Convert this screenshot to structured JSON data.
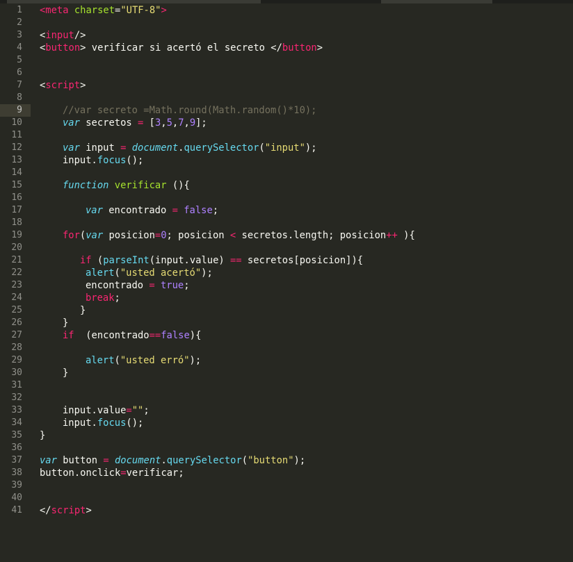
{
  "editor": {
    "lines": [
      {
        "n": "1",
        "indent": 0,
        "tokens": [
          [
            "tag",
            "<meta"
          ],
          [
            "plain",
            " "
          ],
          [
            "attr",
            "charset"
          ],
          [
            "plain",
            "="
          ],
          [
            "str",
            "\"UTF-8\""
          ],
          [
            "tag",
            ">"
          ]
        ]
      },
      {
        "n": "2",
        "indent": 0,
        "tokens": []
      },
      {
        "n": "3",
        "indent": 0,
        "tokens": [
          [
            "plain",
            "<"
          ],
          [
            "tag",
            "input"
          ],
          [
            "plain",
            "/>"
          ]
        ]
      },
      {
        "n": "4",
        "indent": 0,
        "tokens": [
          [
            "plain",
            "<"
          ],
          [
            "tag",
            "button"
          ],
          [
            "plain",
            "> verificar si acertó el secreto </"
          ],
          [
            "tag",
            "button"
          ],
          [
            "plain",
            ">"
          ]
        ]
      },
      {
        "n": "5",
        "indent": 0,
        "tokens": []
      },
      {
        "n": "6",
        "indent": 0,
        "tokens": []
      },
      {
        "n": "7",
        "indent": 0,
        "tokens": [
          [
            "plain",
            "<"
          ],
          [
            "tag",
            "script"
          ],
          [
            "plain",
            ">"
          ]
        ]
      },
      {
        "n": "8",
        "indent": 0,
        "tokens": []
      },
      {
        "n": "9",
        "indent": 33,
        "current": true,
        "tokens": [
          [
            "comment",
            "//var secreto =Math.round(Math.random()*10);"
          ]
        ]
      },
      {
        "n": "10",
        "indent": 33,
        "tokens": [
          [
            "kw",
            "var"
          ],
          [
            "plain",
            " secretos "
          ],
          [
            "op",
            "="
          ],
          [
            "plain",
            " ["
          ],
          [
            "num",
            "3"
          ],
          [
            "plain",
            ","
          ],
          [
            "num",
            "5"
          ],
          [
            "plain",
            ","
          ],
          [
            "num",
            "7"
          ],
          [
            "plain",
            ","
          ],
          [
            "num",
            "9"
          ],
          [
            "plain",
            "];"
          ]
        ]
      },
      {
        "n": "11",
        "indent": 0,
        "tokens": []
      },
      {
        "n": "12",
        "indent": 33,
        "tokens": [
          [
            "kw",
            "var"
          ],
          [
            "plain",
            " input "
          ],
          [
            "op",
            "="
          ],
          [
            "plain",
            " "
          ],
          [
            "kw",
            "document"
          ],
          [
            "plain",
            "."
          ],
          [
            "prop",
            "querySelector"
          ],
          [
            "plain",
            "("
          ],
          [
            "str",
            "\"input\""
          ],
          [
            "plain",
            ");"
          ]
        ]
      },
      {
        "n": "13",
        "indent": 33,
        "tokens": [
          [
            "plain",
            "input."
          ],
          [
            "prop",
            "focus"
          ],
          [
            "plain",
            "();"
          ]
        ]
      },
      {
        "n": "14",
        "indent": 0,
        "tokens": []
      },
      {
        "n": "15",
        "indent": 33,
        "tokens": [
          [
            "kw",
            "function"
          ],
          [
            "plain",
            " "
          ],
          [
            "fn",
            "verificar"
          ],
          [
            "plain",
            " (){"
          ]
        ]
      },
      {
        "n": "16",
        "indent": 0,
        "tokens": []
      },
      {
        "n": "17",
        "indent": 66,
        "tokens": [
          [
            "kw",
            "var"
          ],
          [
            "plain",
            " encontrado "
          ],
          [
            "op",
            "="
          ],
          [
            "plain",
            " "
          ],
          [
            "const",
            "false"
          ],
          [
            "plain",
            ";"
          ]
        ]
      },
      {
        "n": "18",
        "indent": 0,
        "tokens": []
      },
      {
        "n": "19",
        "indent": 33,
        "tokens": [
          [
            "kwc",
            "for"
          ],
          [
            "plain",
            "("
          ],
          [
            "kw",
            "var"
          ],
          [
            "plain",
            " posicion"
          ],
          [
            "op",
            "="
          ],
          [
            "num",
            "0"
          ],
          [
            "plain",
            "; posicion "
          ],
          [
            "op",
            "<"
          ],
          [
            "plain",
            " secretos.length; posicion"
          ],
          [
            "op",
            "++"
          ],
          [
            "plain",
            " ){"
          ]
        ]
      },
      {
        "n": "20",
        "indent": 0,
        "tokens": []
      },
      {
        "n": "21",
        "indent": 58,
        "tokens": [
          [
            "kwc",
            "if"
          ],
          [
            "plain",
            " ("
          ],
          [
            "sup",
            "parseInt"
          ],
          [
            "plain",
            "(input.value) "
          ],
          [
            "op",
            "=="
          ],
          [
            "plain",
            " secretos[posicion]){"
          ]
        ]
      },
      {
        "n": "22",
        "indent": 66,
        "tokens": [
          [
            "sup",
            "alert"
          ],
          [
            "plain",
            "("
          ],
          [
            "str",
            "\"usted acertó\""
          ],
          [
            "plain",
            ");"
          ]
        ]
      },
      {
        "n": "23",
        "indent": 66,
        "tokens": [
          [
            "plain",
            "encontrado "
          ],
          [
            "op",
            "="
          ],
          [
            "plain",
            " "
          ],
          [
            "const",
            "true"
          ],
          [
            "plain",
            ";"
          ]
        ]
      },
      {
        "n": "24",
        "indent": 66,
        "tokens": [
          [
            "kwc",
            "break"
          ],
          [
            "plain",
            ";"
          ]
        ]
      },
      {
        "n": "25",
        "indent": 58,
        "tokens": [
          [
            "plain",
            "}"
          ]
        ]
      },
      {
        "n": "26",
        "indent": 33,
        "tokens": [
          [
            "plain",
            "}"
          ]
        ]
      },
      {
        "n": "27",
        "indent": 33,
        "tokens": [
          [
            "kwc",
            "if"
          ],
          [
            "plain",
            "  (encontrado"
          ],
          [
            "op",
            "=="
          ],
          [
            "const",
            "false"
          ],
          [
            "plain",
            "){"
          ]
        ]
      },
      {
        "n": "28",
        "indent": 0,
        "tokens": []
      },
      {
        "n": "29",
        "indent": 66,
        "tokens": [
          [
            "sup",
            "alert"
          ],
          [
            "plain",
            "("
          ],
          [
            "str",
            "\"usted erró\""
          ],
          [
            "plain",
            ");"
          ]
        ]
      },
      {
        "n": "30",
        "indent": 33,
        "tokens": [
          [
            "plain",
            "}"
          ]
        ]
      },
      {
        "n": "31",
        "indent": 0,
        "tokens": []
      },
      {
        "n": "32",
        "indent": 0,
        "tokens": []
      },
      {
        "n": "33",
        "indent": 33,
        "tokens": [
          [
            "plain",
            "input.value"
          ],
          [
            "op",
            "="
          ],
          [
            "str",
            "\"\""
          ],
          [
            "plain",
            ";"
          ]
        ]
      },
      {
        "n": "34",
        "indent": 33,
        "tokens": [
          [
            "plain",
            "input."
          ],
          [
            "prop",
            "focus"
          ],
          [
            "plain",
            "();"
          ]
        ]
      },
      {
        "n": "35",
        "indent": 0,
        "tokens": [
          [
            "plain",
            "}"
          ]
        ]
      },
      {
        "n": "36",
        "indent": 0,
        "tokens": []
      },
      {
        "n": "37",
        "indent": 0,
        "tokens": [
          [
            "kw",
            "var"
          ],
          [
            "plain",
            " button "
          ],
          [
            "op",
            "="
          ],
          [
            "plain",
            " "
          ],
          [
            "kw",
            "document"
          ],
          [
            "plain",
            "."
          ],
          [
            "prop",
            "querySelector"
          ],
          [
            "plain",
            "("
          ],
          [
            "str",
            "\"button\""
          ],
          [
            "plain",
            ");"
          ]
        ]
      },
      {
        "n": "38",
        "indent": 0,
        "tokens": [
          [
            "plain",
            "button.onclick"
          ],
          [
            "op",
            "="
          ],
          [
            "plain",
            "verificar;"
          ]
        ]
      },
      {
        "n": "39",
        "indent": 0,
        "tokens": []
      },
      {
        "n": "40",
        "indent": 0,
        "tokens": []
      },
      {
        "n": "41",
        "indent": 0,
        "tokens": [
          [
            "plain",
            "</"
          ],
          [
            "tag",
            "script"
          ],
          [
            "plain",
            ">"
          ]
        ]
      }
    ]
  }
}
